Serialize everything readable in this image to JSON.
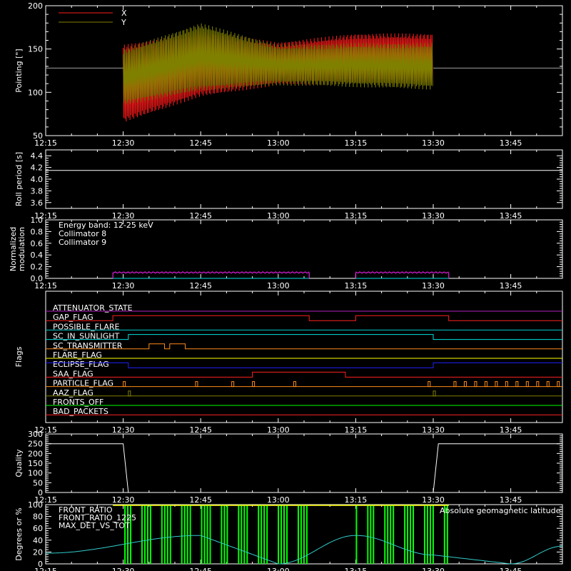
{
  "time_ticks": [
    "12:15",
    "12:30",
    "12:45",
    "13:00",
    "13:15",
    "13:30",
    "13:45"
  ],
  "colors": {
    "background": "#000000",
    "axes": "#ffffff",
    "x_series": "#ff1a1a",
    "y_series": "#808000",
    "collimator8": "#00e0e0",
    "collimator9": "#ff22ff",
    "front_ratio": "#ffff00",
    "front_ratio_1225": "#00ff00",
    "max_det": "#ff8c1a",
    "geomag": "#33cccc"
  },
  "chart_data": [
    {
      "type": "line",
      "ylabel": "Pointing [\"]",
      "ylim": [
        50,
        200
      ],
      "yticks": [
        "50",
        "100",
        "150",
        "200"
      ],
      "series": [
        {
          "name": "X",
          "x": [
            "12:30",
            "12:45",
            "13:00",
            "13:15",
            "13:30"
          ],
          "y_mean": [
            128,
            125,
            130,
            130,
            130
          ],
          "y_min": [
            65,
            95,
            108,
            110,
            110
          ],
          "y_max": [
            155,
            170,
            158,
            168,
            168
          ]
        },
        {
          "name": "Y",
          "x": [
            "12:30",
            "12:45",
            "13:00",
            "13:15",
            "13:30"
          ],
          "y_mean": [
            128,
            128,
            130,
            130,
            130
          ],
          "y_min": [
            85,
            102,
            108,
            106,
            103
          ],
          "y_max": [
            150,
            180,
            155,
            157,
            157
          ]
        }
      ],
      "reference_level": 128,
      "coverage": [
        "12:30",
        "13:30"
      ]
    },
    {
      "type": "line",
      "ylabel": "Roll period [s]",
      "ylim": [
        3.5,
        4.5
      ],
      "yticks": [
        "3.6",
        "3.8",
        "4.0",
        "4.2",
        "4.4"
      ],
      "series": [
        {
          "name": "roll",
          "x": [
            "12:15",
            "13:55"
          ],
          "y": [
            4.15,
            4.15
          ]
        }
      ]
    },
    {
      "type": "line",
      "ylabel": "Normalized modulation",
      "ylim": [
        0,
        1.0
      ],
      "yticks": [
        "0.0",
        "0.2",
        "0.4",
        "0.6",
        "0.8",
        "1.0"
      ],
      "annotation": "Energy band: 12-25 keV",
      "legend": [
        "Collimator 8",
        "Collimator 9"
      ],
      "series": [
        {
          "name": "Collimator 8",
          "segments": [
            [
              "12:28",
              "13:06"
            ],
            [
              "13:15",
              "13:33"
            ]
          ],
          "y": 0.0
        },
        {
          "name": "Collimator 9",
          "segments": [
            [
              "12:28",
              "13:06"
            ],
            [
              "13:15",
              "13:33"
            ]
          ],
          "y": 0.1
        }
      ]
    },
    {
      "type": "line",
      "ylabel": "Flags",
      "flags": [
        {
          "name": "ATTENUATOR_STATE",
          "color": "#b020c0",
          "steps": [
            [
              "12:15",
              0
            ]
          ]
        },
        {
          "name": "GAP_FLAG",
          "color": "#ff2020",
          "steps": [
            [
              "12:15",
              0
            ],
            [
              "12:28",
              1
            ],
            [
              "13:06",
              0
            ],
            [
              "13:15",
              1
            ],
            [
              "13:33",
              0
            ]
          ]
        },
        {
          "name": "POSSIBLE_FLARE",
          "color": "#00c8c8",
          "steps": [
            [
              "12:15",
              0
            ]
          ]
        },
        {
          "name": "SC_IN_SUNLIGHT",
          "color": "#00e0e0",
          "steps": [
            [
              "12:15",
              0
            ],
            [
              "12:31",
              1
            ],
            [
              "13:30",
              0
            ]
          ]
        },
        {
          "name": "SC_TRANSMITTER",
          "color": "#ff8c1a",
          "steps": [
            [
              "12:15",
              0
            ],
            [
              "12:35",
              1
            ],
            [
              "12:38",
              0
            ],
            [
              "12:39",
              1
            ],
            [
              "12:42",
              0
            ]
          ]
        },
        {
          "name": "FLARE_FLAG",
          "color": "#ffff00",
          "steps": [
            [
              "12:15",
              0
            ]
          ]
        },
        {
          "name": "ECLIPSE_FLAG",
          "color": "#2020ff",
          "steps": [
            [
              "12:15",
              1
            ],
            [
              "12:31",
              0
            ],
            [
              "13:30",
              1
            ]
          ]
        },
        {
          "name": "SAA_FLAG",
          "color": "#ff2020",
          "steps": [
            [
              "12:15",
              0
            ],
            [
              "12:55",
              1
            ],
            [
              "13:13",
              0
            ]
          ]
        },
        {
          "name": "PARTICLE_FLAG",
          "color": "#ff8c1a",
          "spikes": [
            "12:30",
            "12:44",
            "12:51",
            "12:55",
            "13:03",
            "13:29",
            "13:34",
            "13:36",
            "13:38",
            "13:40",
            "13:42",
            "13:44",
            "13:46",
            "13:48",
            "13:50",
            "13:52",
            "13:54"
          ]
        },
        {
          "name": "AAZ_FLAG",
          "color": "#808000",
          "spikes": [
            "12:31",
            "13:30"
          ]
        },
        {
          "name": "FRONTS_OFF",
          "color": "#00ff00",
          "steps": [
            [
              "12:15",
              0
            ]
          ]
        },
        {
          "name": "BAD_PACKETS",
          "color": "#ff2020",
          "steps": [
            [
              "12:15",
              0
            ]
          ]
        }
      ]
    },
    {
      "type": "line",
      "ylabel": "Quality",
      "ylim": [
        0,
        300
      ],
      "yticks": [
        "0",
        "50",
        "100",
        "150",
        "200",
        "250",
        "300"
      ],
      "series": [
        {
          "name": "quality",
          "x": [
            "12:15",
            "12:30",
            "12:31",
            "13:30",
            "13:31",
            "13:55"
          ],
          "y": [
            250,
            250,
            0,
            0,
            250,
            250
          ]
        }
      ]
    },
    {
      "type": "line",
      "ylabel": "Degrees or %",
      "ylim": [
        0,
        100
      ],
      "yticks": [
        "0",
        "20",
        "40",
        "60",
        "80",
        "100"
      ],
      "legend": [
        "FRONT_RATIO",
        "FRONT_RATIO_1225",
        "MAX_DET_VS_TOT"
      ],
      "annotation": "Absolute geomagnetic latitude",
      "series": [
        {
          "name": "Absolute geomagnetic latitude",
          "x": [
            "12:15",
            "12:45",
            "13:00",
            "13:15",
            "13:30",
            "13:45",
            "13:55"
          ],
          "y": [
            18,
            48,
            0,
            48,
            15,
            0,
            30
          ]
        },
        {
          "name": "FRONT_RATIO_1225",
          "segments": [
            [
              "12:28",
              "13:06"
            ],
            [
              "13:15",
              "13:33"
            ]
          ],
          "y": 100
        },
        {
          "name": "FRONT_RATIO",
          "y": 100
        }
      ]
    }
  ]
}
